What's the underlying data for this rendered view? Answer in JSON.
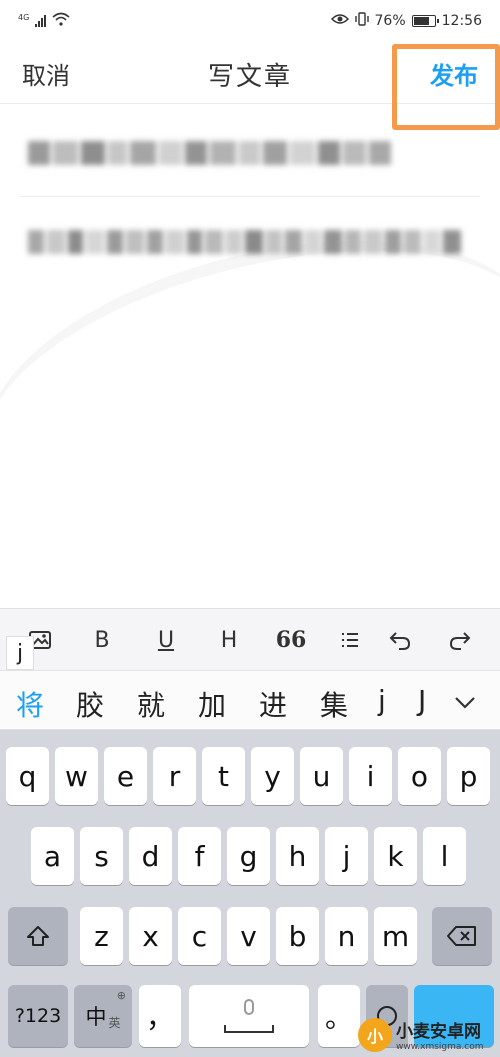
{
  "status_bar": {
    "network": "4G",
    "battery_level": "76%",
    "time": "12:56"
  },
  "header": {
    "cancel_label": "取消",
    "title": "写文章",
    "publish_label": "发布"
  },
  "editor": {
    "title_field_state": "blurred",
    "body_field_state": "blurred"
  },
  "format_toolbar": {
    "items": [
      {
        "name": "insert-image-icon"
      },
      {
        "name": "bold-icon",
        "label": "B"
      },
      {
        "name": "underline-icon",
        "label": "U"
      },
      {
        "name": "heading-icon",
        "label": "H"
      },
      {
        "name": "quote-icon",
        "label": "66"
      },
      {
        "name": "list-icon"
      },
      {
        "name": "undo-icon"
      },
      {
        "name": "redo-icon"
      }
    ]
  },
  "input_preview": "j",
  "candidates": [
    "将",
    "胶",
    "就",
    "加",
    "进",
    "集",
    "j",
    "J"
  ],
  "keyboard": {
    "row1": [
      "q",
      "w",
      "e",
      "r",
      "t",
      "y",
      "u",
      "i",
      "o",
      "p"
    ],
    "row2": [
      "a",
      "s",
      "d",
      "f",
      "g",
      "h",
      "j",
      "k",
      "l"
    ],
    "row3": [
      "z",
      "x",
      "c",
      "v",
      "b",
      "n",
      "m"
    ],
    "numbers_label": "?123",
    "lang_label": "中",
    "lang_sub": "英",
    "comma_label": "，",
    "period_label": "。"
  },
  "watermark": {
    "logo_text": "小",
    "main": "小麦安卓网",
    "sub": "www.xmsigma.com"
  }
}
